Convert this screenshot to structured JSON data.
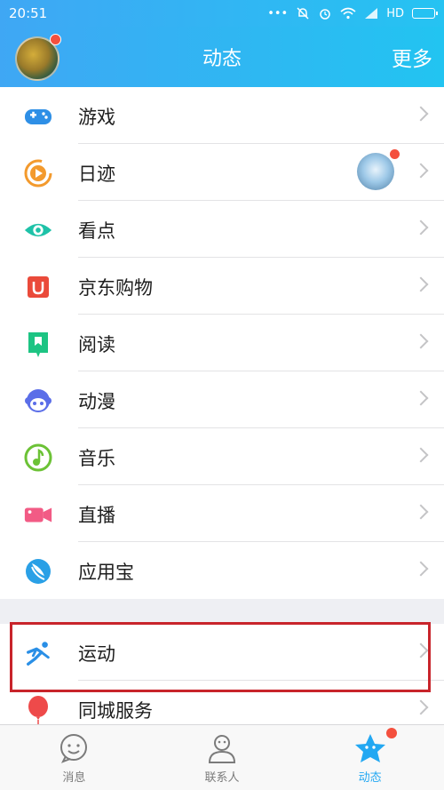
{
  "status_bar": {
    "time": "20:51",
    "dots": "•••",
    "network": "HD"
  },
  "header": {
    "title": "动态",
    "more": "更多"
  },
  "menu_group1": [
    {
      "label": "游戏",
      "icon": "gamepad-icon"
    },
    {
      "label": "日迹",
      "icon": "daily-trace-icon"
    },
    {
      "label": "看点",
      "icon": "eye-icon"
    },
    {
      "label": "京东购物",
      "icon": "jd-shopping-icon"
    },
    {
      "label": "阅读",
      "icon": "reading-bookmark-icon"
    },
    {
      "label": "动漫",
      "icon": "anime-face-icon"
    },
    {
      "label": "音乐",
      "icon": "music-note-icon"
    },
    {
      "label": "直播",
      "icon": "live-camera-icon"
    },
    {
      "label": "应用宝",
      "icon": "app-store-icon"
    }
  ],
  "menu_group2": [
    {
      "label": "运动",
      "icon": "running-icon"
    },
    {
      "label": "同城服务",
      "icon": "balloon-icon"
    }
  ],
  "tabs": [
    {
      "label": "消息",
      "icon": "message-smile-icon",
      "active": false
    },
    {
      "label": "联系人",
      "icon": "contacts-person-icon",
      "active": false
    },
    {
      "label": "动态",
      "icon": "star-icon",
      "active": true
    }
  ],
  "colors": {
    "header_start": "#3fa7f4",
    "header_end": "#22c4f1",
    "highlight": "#c8242b",
    "badge": "#f4503e",
    "active_tab": "#23a8f2"
  }
}
